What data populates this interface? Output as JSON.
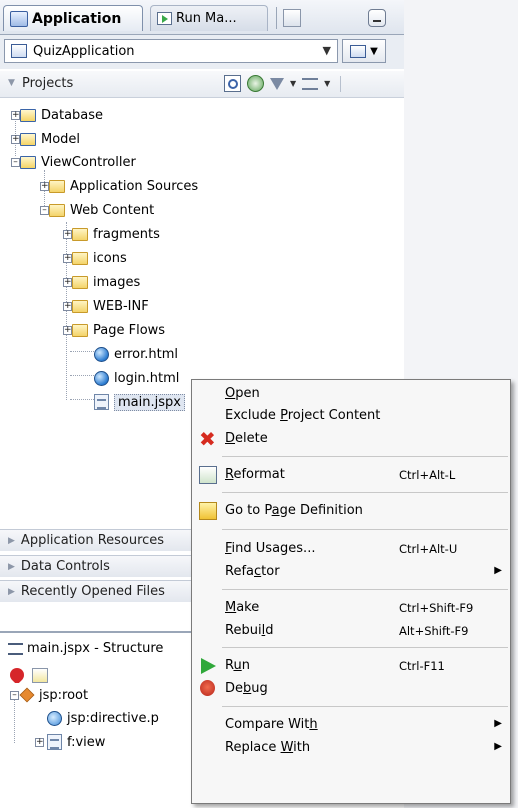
{
  "tabs": {
    "application": "Application",
    "run_manager": "Run Ma..."
  },
  "app_selector": {
    "value": "QuizApplication"
  },
  "projects": {
    "header": "Projects"
  },
  "tree": {
    "database": "Database",
    "model": "Model",
    "viewcontroller": "ViewController",
    "application_sources": "Application Sources",
    "web_content": "Web Content",
    "fragments": "fragments",
    "icons": "icons",
    "images": "images",
    "web_inf": "WEB-INF",
    "page_flows": "Page Flows",
    "error_html": "error.html",
    "login_html": "login.html",
    "main_jspx": "main.jspx"
  },
  "accordions": {
    "application_resources": "Application Resources",
    "data_controls": "Data Controls",
    "recently_opened": "Recently Opened Files"
  },
  "structure": {
    "title": "main.jspx - Structure",
    "root": "jsp:root",
    "directive": "jsp:directive.p",
    "view": "f:view"
  },
  "context_menu": {
    "open": {
      "pre": "",
      "ul": "O",
      "post": "pen",
      "shortcut": ""
    },
    "exclude": {
      "pre": "Exclude ",
      "ul": "P",
      "post": "roject Content",
      "shortcut": ""
    },
    "delete": {
      "pre": "",
      "ul": "D",
      "post": "elete",
      "shortcut": ""
    },
    "reformat": {
      "pre": "",
      "ul": "R",
      "post": "eformat",
      "shortcut": "Ctrl+Alt-L"
    },
    "page_def": {
      "pre": "Go to P",
      "ul": "a",
      "post": "ge Definition",
      "shortcut": ""
    },
    "find_usages": {
      "pre": "",
      "ul": "F",
      "post": "ind Usages...",
      "shortcut": "Ctrl+Alt-U"
    },
    "refactor": {
      "pre": "Refa",
      "ul": "c",
      "post": "tor",
      "shortcut": ""
    },
    "make": {
      "pre": "",
      "ul": "M",
      "post": "ake",
      "shortcut": "Ctrl+Shift-F9"
    },
    "rebuild": {
      "pre": "Rebui",
      "ul": "l",
      "post": "d",
      "shortcut": "Alt+Shift-F9"
    },
    "run": {
      "pre": "R",
      "ul": "u",
      "post": "n",
      "shortcut": "Ctrl-F11"
    },
    "debug": {
      "pre": "De",
      "ul": "b",
      "post": "ug",
      "shortcut": ""
    },
    "compare": {
      "pre": "Compare Wit",
      "ul": "h",
      "post": "",
      "shortcut": ""
    },
    "replace": {
      "pre": "Replace ",
      "ul": "W",
      "post": "ith",
      "shortcut": ""
    }
  },
  "colors": {
    "menu_bg": "#f7f7f7",
    "selection": "#dfe6f1",
    "accent": "#2b7bd0"
  }
}
